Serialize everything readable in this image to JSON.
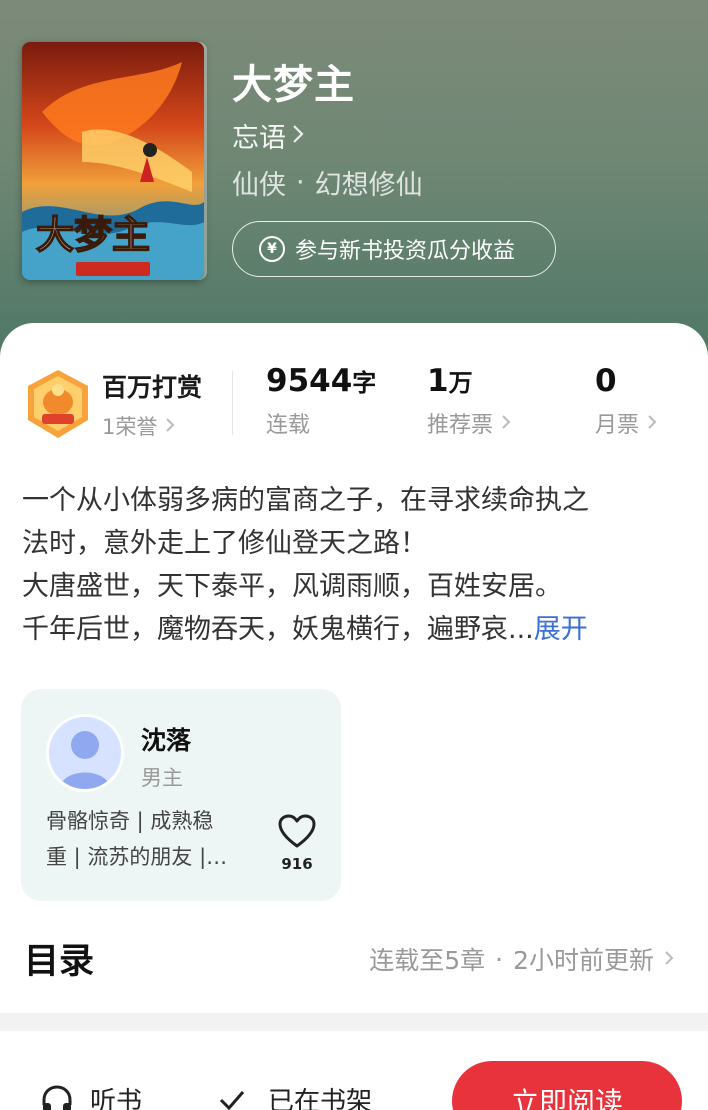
{
  "book": {
    "title": "大梦主",
    "author": "忘语",
    "genre": "仙侠",
    "subgenre": "幻想修仙",
    "dot": "·",
    "invest_label": "参与新书投资瓜分收益",
    "yen_symbol": "¥",
    "cover_title_text": "大梦主"
  },
  "stats": {
    "honor_title": "百万打赏",
    "honor_sub": "1荣誉",
    "words_value": "9544",
    "words_unit": "字",
    "words_label": "连载",
    "votes_value": "1",
    "votes_unit": "万",
    "votes_label": "推荐票",
    "monthly_value": "0",
    "monthly_label": "月票"
  },
  "synopsis": {
    "line1": "一个从小体弱多病的富商之子，在寻求续命执之",
    "line2": "法时，意外走上了修仙登天之路！",
    "line3": "大唐盛世，天下泰平，风调雨顺，百姓安居。",
    "line4": "千年后世，魔物吞天，妖鬼横行，遍野哀...",
    "expand": "展开"
  },
  "character": {
    "name": "沈落",
    "role": "男主",
    "tags_line1": "骨骼惊奇 | 成熟稳",
    "tags_line2": "重 | 流苏的朋友 |…",
    "likes": "916"
  },
  "toc": {
    "title": "目录",
    "status": "连载至5章",
    "dot": "·",
    "updated": "2小时前更新"
  },
  "bottom": {
    "listen": "听书",
    "shelf": "已在书架",
    "read": "立即阅读"
  },
  "colors": {
    "accent_red": "#e8323c",
    "link_blue": "#3a6fd8",
    "header_green": "#6f8774",
    "char_card_bg": "#eef6f5"
  },
  "icons": {
    "author_chevron": "chevron-right-icon",
    "invest": "yen-coin-icon",
    "heart": "heart-outline-icon",
    "listen": "headphones-icon",
    "shelf": "check-icon"
  }
}
